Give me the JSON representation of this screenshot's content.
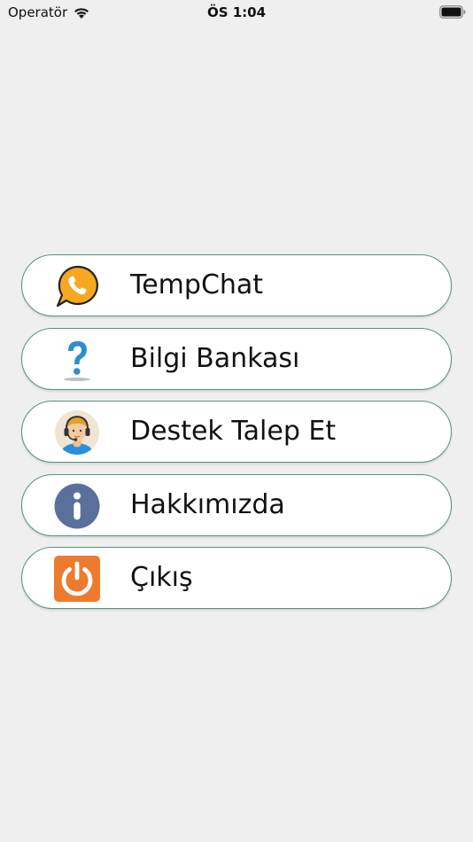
{
  "status_bar": {
    "carrier": "Operatör",
    "time": "ÖS 1:04"
  },
  "menu": {
    "items": [
      {
        "label": "TempChat",
        "icon": "chat-phone-icon"
      },
      {
        "label": "Bilgi Bankası",
        "icon": "question-icon"
      },
      {
        "label": "Destek Talep Et",
        "icon": "support-agent-icon"
      },
      {
        "label": "Hakkımızda",
        "icon": "info-icon"
      },
      {
        "label": "Çıkış",
        "icon": "power-icon"
      }
    ]
  },
  "colors": {
    "background": "#efefef",
    "button_border": "#5a8c8a",
    "chat_icon": "#f7a823",
    "question_icon": "#2a8fd0",
    "info_icon": "#5b6f9b",
    "power_icon": "#ee7a2d"
  }
}
